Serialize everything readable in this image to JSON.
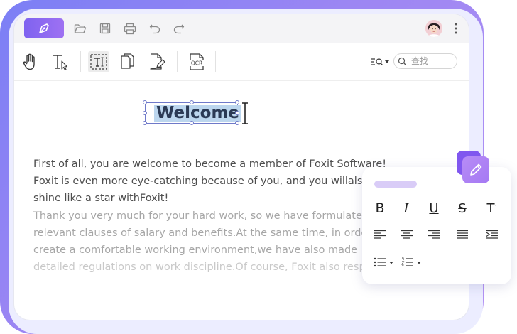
{
  "titlebar": {
    "icons": [
      "folder-open-icon",
      "save-icon",
      "print-icon",
      "undo-icon",
      "redo-icon"
    ],
    "accent": "#8b68f1"
  },
  "toolbar": {
    "tools": [
      "hand-icon",
      "select-text-icon",
      "edit-text-icon",
      "edit-page-icon",
      "edit-document-icon",
      "ocr-icon"
    ],
    "ocr_label": "OCR",
    "search": {
      "placeholder": "查找",
      "value": ""
    }
  },
  "document": {
    "heading": "Welcome",
    "paragraph_1": [
      "First of all, you are welcome to become a member of Foxit Software!",
      "Foxit is even more eye-catching because of you, and you willalso",
      "shine like a star withFoxit!"
    ],
    "paragraph_2": [
      "Thank you very much for your hard work, so we have formulated the",
      "relevant clauses of salary and benefits.At the same time, in order to",
      "create a comfortable working environment,we have also made",
      "detailed regulations on work discipline.Of course, Foxit also respects"
    ]
  },
  "format_panel": {
    "bold": "B",
    "italic": "I",
    "underline": "U",
    "strikethrough": "S",
    "superscript_base": "T",
    "superscript_mark": "¹",
    "align_icons": [
      "align-left-icon",
      "align-center-icon",
      "align-right-icon",
      "align-justify-icon",
      "indent-icon"
    ],
    "list_icons": [
      "bullet-list-icon",
      "numbered-list-icon"
    ]
  },
  "colors": {
    "brand": "#8b68f1",
    "selection": "#bcd6ee",
    "frame": "#7b7ff5"
  }
}
